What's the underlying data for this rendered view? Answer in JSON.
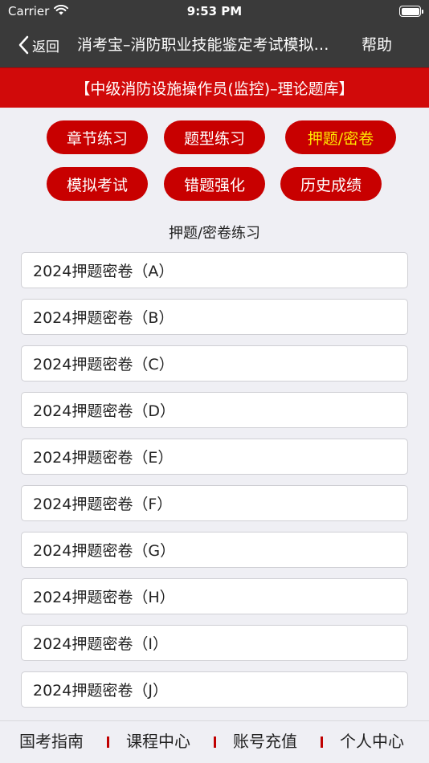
{
  "status_bar": {
    "carrier": "Carrier",
    "time": "9:53 PM",
    "wifi_icon": "wifi-icon",
    "battery_icon": "battery-icon"
  },
  "nav": {
    "back_label": "返回",
    "title": "消考宝–消防职业技能鉴定考试模拟题库",
    "help_label": "帮助"
  },
  "banner": {
    "text": "【中级消防设施操作员(监控)–理论题库】"
  },
  "modes": [
    {
      "label": "章节练习",
      "active": false
    },
    {
      "label": "题型练习",
      "active": false
    },
    {
      "label": "押题/密卷",
      "active": true
    },
    {
      "label": "模拟考试",
      "active": false
    },
    {
      "label": "错题强化",
      "active": false
    },
    {
      "label": "历史成绩",
      "active": false
    }
  ],
  "section_label": "押题/密卷练习",
  "papers": [
    {
      "label": "2024押题密卷（A）"
    },
    {
      "label": "2024押题密卷（B）"
    },
    {
      "label": "2024押题密卷（C）"
    },
    {
      "label": "2024押题密卷（D）"
    },
    {
      "label": "2024押题密卷（E）"
    },
    {
      "label": "2024押题密卷（F）"
    },
    {
      "label": "2024押题密卷（G）"
    },
    {
      "label": "2024押题密卷（H）"
    },
    {
      "label": "2024押题密卷（I）"
    },
    {
      "label": "2024押题密卷（J）"
    }
  ],
  "tabs": [
    {
      "label": "国考指南"
    },
    {
      "label": "课程中心"
    },
    {
      "label": "账号充值"
    },
    {
      "label": "个人中心"
    }
  ],
  "colors": {
    "header_bg": "#3a3a3a",
    "brand_red": "#d10a0a",
    "pill_red": "#c80000",
    "active_text": "#ffe600",
    "page_bg": "#efeff4"
  }
}
